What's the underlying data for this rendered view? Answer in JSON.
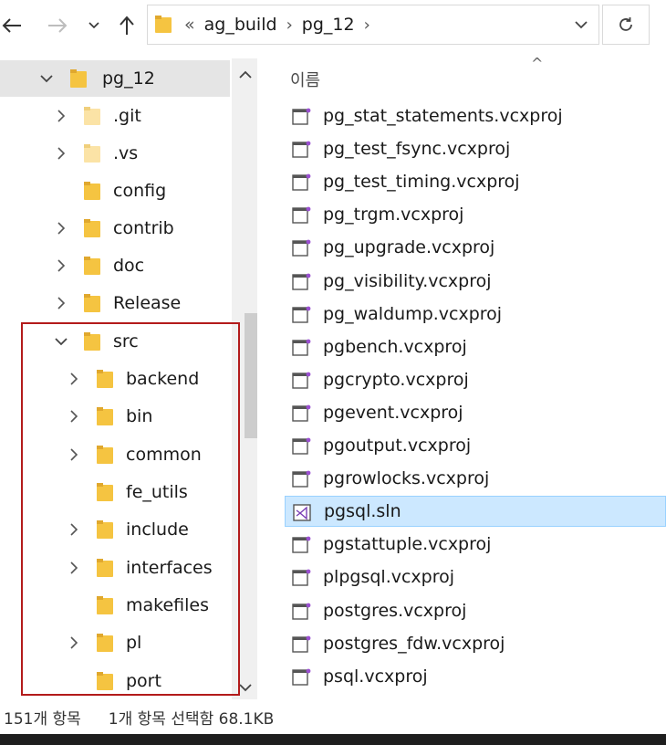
{
  "address": {
    "overflow_glyph": "«",
    "segments": [
      "ag_build",
      "pg_12"
    ]
  },
  "tree": {
    "items": [
      {
        "label": "pg_12",
        "expanded": true,
        "selected": true
      },
      {
        "label": ".git",
        "expandable": true
      },
      {
        "label": ".vs",
        "expandable": true
      },
      {
        "label": "config",
        "expandable": false
      },
      {
        "label": "contrib",
        "expandable": true
      },
      {
        "label": "doc",
        "expandable": true
      },
      {
        "label": "Release",
        "expandable": true
      },
      {
        "label": "src",
        "expanded": true
      },
      {
        "label": "backend",
        "expandable": true
      },
      {
        "label": "bin",
        "expandable": true
      },
      {
        "label": "common",
        "expandable": true
      },
      {
        "label": "fe_utils",
        "expandable": false
      },
      {
        "label": "include",
        "expandable": true
      },
      {
        "label": "interfaces",
        "expandable": true
      },
      {
        "label": "makefiles",
        "expandable": false
      },
      {
        "label": "pl",
        "expandable": true
      },
      {
        "label": "port",
        "expandable": false
      }
    ]
  },
  "files": {
    "column_name": "이름",
    "items": [
      {
        "name": "pg_stat_statements.vcxproj"
      },
      {
        "name": "pg_test_fsync.vcxproj"
      },
      {
        "name": "pg_test_timing.vcxproj"
      },
      {
        "name": "pg_trgm.vcxproj"
      },
      {
        "name": "pg_upgrade.vcxproj"
      },
      {
        "name": "pg_visibility.vcxproj"
      },
      {
        "name": "pg_waldump.vcxproj"
      },
      {
        "name": "pgbench.vcxproj"
      },
      {
        "name": "pgcrypto.vcxproj"
      },
      {
        "name": "pgevent.vcxproj"
      },
      {
        "name": "pgoutput.vcxproj"
      },
      {
        "name": "pgrowlocks.vcxproj"
      },
      {
        "name": "pgsql.sln",
        "selected": true
      },
      {
        "name": "pgstattuple.vcxproj"
      },
      {
        "name": "plpgsql.vcxproj"
      },
      {
        "name": "postgres.vcxproj"
      },
      {
        "name": "postgres_fdw.vcxproj"
      },
      {
        "name": "psql.vcxproj"
      }
    ]
  },
  "status": {
    "item_count": "151개 항목",
    "selection": "1개 항목 선택함 68.1KB"
  },
  "colors": {
    "folder": "#f5c441",
    "selection_bg": "#cce8ff",
    "annotation_box": "#b31b1b"
  }
}
